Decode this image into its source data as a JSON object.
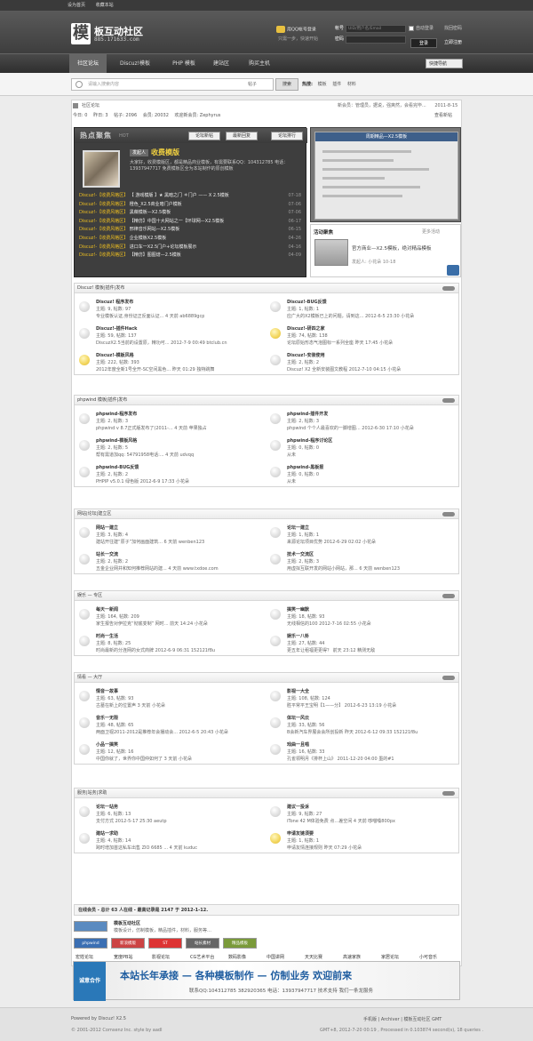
{
  "topbar": {
    "links": [
      "设为首页",
      "收藏本站"
    ]
  },
  "header": {
    "logo_mark": "模",
    "logo_title": "板互动社区",
    "logo_url": "885.171633.com",
    "qq_login": "用QQ帐号登录",
    "qq_sub": "只需一步，快速开始",
    "account_label": "帐号",
    "account_placeholder": "UID/用户名/Email",
    "password_label": "密码",
    "remember": "自动登录",
    "forgot": "找回密码",
    "login": "登录",
    "register": "立即注册"
  },
  "nav": {
    "items": [
      "社区论坛",
      "Discuz!模板",
      "PHP 模板",
      "建站区",
      "购买主机"
    ],
    "quick": "快捷导航"
  },
  "search": {
    "placeholder": "请输入搜索内容",
    "type": "帖子",
    "button": "搜索",
    "hot_label": "热搜:",
    "hot_items": [
      "模板",
      "插件",
      "材料"
    ]
  },
  "breadcrumb": {
    "home": "社区论坛"
  },
  "members_line": "新会员：管理员，据说，强爽然，会看完毕...",
  "date": "2011-8-15",
  "stats": {
    "today": "今日: 0",
    "yesterday": "昨日: 3",
    "posts": "帖子: 2096",
    "members": "会员: 20032",
    "newest": "欢迎新会员: Zephyrus",
    "new_posts": "查看新帖"
  },
  "hot": {
    "title": "热点聚焦",
    "sub": "HOT",
    "tabs": [
      "论坛新帖",
      "最新回复",
      "论坛排行"
    ],
    "name_badge": "发起人",
    "name": "收费模版",
    "intro": "大家好，收费模版区，都是精品商业模板，有需要联系QQ：104312785 电话：13937947717 免费模板区全为本站制作的原创模板",
    "threads": [
      {
        "tag": "Discuz!-【收费风格区】",
        "title": "【 游戏模版 】★ 黑暗之门 ＊门户 —— X 2.5模板",
        "date": "07-18"
      },
      {
        "tag": "Discuz!-【收费风格区】",
        "title": "橙色_X2.5商业暗门户模板",
        "date": "07-06"
      },
      {
        "tag": "Discuz!-【收费风格区】",
        "title": "黑薇模板—X2.5模板",
        "date": "07-06"
      },
      {
        "tag": "Discuz!-【收费风格区】",
        "title": "【精仿】中国十大网站之一【环球网—X2.5模板",
        "date": "06-17"
      },
      {
        "tag": "Discuz!-【收费风格区】",
        "title": "邢律音乐网站—X2.5模板",
        "date": "06-15"
      },
      {
        "tag": "Discuz!-【收费风格区】",
        "title": "企业模板X2.5模板",
        "date": "04-26"
      },
      {
        "tag": "Discuz!-【收费风格区】",
        "title": "进口车一X2.5门户+论坛模板展示",
        "date": "04-16"
      },
      {
        "tag": "Discuz!-【收费风格区】",
        "title": "【精仿】图图谱—2.5模板",
        "date": "04-09"
      }
    ]
  },
  "slide": {
    "caption": "周期精品—X2.5模板"
  },
  "activity": {
    "title": "活动聚焦",
    "more": "更多活动",
    "name": "官方商业—X2.5模板，绝对精品模板",
    "meta": "发起人: 小花朵 10-18"
  },
  "categories": [
    {
      "title": "Discuz! 模板|插件|发布",
      "forums": [
        {
          "name": "Discuz! 程序发布",
          "stat": "主题: 9, 帖数: 97",
          "last": "专业模板认证,身份证正反面认证... 4 天前 ab6889gcp",
          "new": false
        },
        {
          "name": "Discuz!-BUG反馈",
          "stat": "主题: 1, 帖数: 1",
          "last": "应广大的X2模板已上的问题，请到这... 2012-6-5 23:30 小花朵",
          "new": false
        },
        {
          "name": "Discuz!-插件Hack",
          "stat": "主题: 59, 帖数: 137",
          "last": "DiscuzX2.5当前的设置原，精功可... 2012-7-9 00:49 btclub.cn",
          "new": false
        },
        {
          "name": "Discuz!-研四之家",
          "stat": "主题: 74, 帖数: 138",
          "last": "论坛原始形态气泡图标一系列全座 昨天 17:45 小花朵",
          "new": true
        },
        {
          "name": "Discuz!-模板风格",
          "stat": "主题: 222, 帖数: 393",
          "last": "2012年度全新1号全开-SC空间黑色... 昨天 01:29 独特跳舞",
          "new": true
        },
        {
          "name": "Discuz!-安装使用",
          "stat": "主题: 2, 帖数: 2",
          "last": "Discuz! X2 全新安装图文教程 2012-7-10 04:15 小花朵",
          "new": false
        }
      ]
    },
    {
      "title": "phpwind 模板|插件|发布",
      "forums": [
        {
          "name": "phpwind-程序发布",
          "stat": "主题: 2, 帖数: 3",
          "last": "phpwind v 8.7正式版发布了(2011-... 4 天前 苹果独占",
          "new": false
        },
        {
          "name": "phpwind-插件开发",
          "stat": "主题: 2, 帖数: 3",
          "last": "phpwind 个个人最喜欢的一脚增图... 2012-6-30 17:10 小花朵",
          "new": false
        },
        {
          "name": "phpwind-模板风格",
          "stat": "主题: 2, 帖数: 5",
          "last": "帮有需道加qq: 54791958电话:... 4 天前 udvqq",
          "new": false
        },
        {
          "name": "phpwind-程序讨论区",
          "stat": "主题: 0, 帖数: 0",
          "last": "从未",
          "new": false
        },
        {
          "name": "phpwind-BUG反馈",
          "stat": "主题: 2, 帖数: 2",
          "last": "PHPIP v5.0.1 绿色版 2012-6-9 17:33 小花朵",
          "new": false
        },
        {
          "name": "phpwind-黑板报",
          "stat": "主题: 0, 帖数: 0",
          "last": "从未",
          "new": false
        }
      ]
    },
    {
      "title": "网站|论坛|建立区",
      "forums": [
        {
          "name": "网站一建立",
          "stat": "主题: 3, 帖数: 4",
          "last": "建站开往建“原子”加何画面建筑... 6 天前 wenben123",
          "new": false
        },
        {
          "name": "论坛一建立",
          "stat": "主题: 1, 帖数: 1",
          "last": "来源论坛项目优势 2012-6-29 02:02 小花朵",
          "new": false
        },
        {
          "name": "站长一交流",
          "stat": "主题: 2, 帖数: 2",
          "last": "五金企业网并和知何推荐网站的建... 4 天前 www.txdoe.com",
          "new": false
        },
        {
          "name": "技术一交流区",
          "stat": "主题: 2, 帖数: 3",
          "last": "用虚拟互联开发的网站小网站，那... 6 天前 wenben123",
          "new": false
        }
      ]
    },
    {
      "title": "娱乐 — 专区",
      "forums": [
        {
          "name": "每天一新闻",
          "stat": "主题: 164, 帖数: 209",
          "last": "家生报告对伊拉克“彻底变制” 网时... 前天 14:24 小花朵",
          "new": false
        },
        {
          "name": "搞笑一幽默",
          "stat": "主题: 18, 帖数: 93",
          "last": "无线相信的100 2012-7-16 02:55 小花朵",
          "new": false
        },
        {
          "name": "时尚一生活",
          "stat": "主题: 8, 帖数: 25",
          "last": "时尚最新的分连网的女式商牌 2012-6-9 06:31 152121f8u",
          "new": false
        },
        {
          "name": "娱乐一八卦",
          "stat": "主题: 27, 帖数: 44",
          "last": "更五年让租福更更得？ 前天 23:12 精测无敌",
          "new": false
        }
      ]
    },
    {
      "title": "情看 — 大厅",
      "forums": [
        {
          "name": "情音一故事",
          "stat": "主题: 63, 帖数: 93",
          "last": "古墓在新上的位置声 3 天前 小花朵",
          "new": false
        },
        {
          "name": "影视一大全",
          "stat": "主题: 108, 帖数: 124",
          "last": "胜平常平王宝明【1——分】 2012-6-23 13:19 小花朵",
          "new": false
        },
        {
          "name": "音乐一无限",
          "stat": "主题: 48, 帖数: 65",
          "last": "两面卫视2011-2012是推荐年会播动会... 2012-6-5 20:43 小花朵",
          "new": false
        },
        {
          "name": "体坛一风云",
          "stat": "主题: 33, 帖数: 56",
          "last": "B会新汽车界展会会所创投新 昨天 2012-6-12 09:33 152121f8u",
          "new": false
        },
        {
          "name": "小品一搞笑",
          "stat": "主题: 12, 帖数: 16",
          "last": "中国你就了，世界你中国仲如何了 3 天前 小花朵",
          "new": false
        },
        {
          "name": "戏曲一且唱",
          "stat": "主题: 16, 帖数: 33",
          "last": "孔雀领明月《排杯上山》 2011-12-20 04:00 墨的#1",
          "new": false
        }
      ]
    },
    {
      "title": "服务|站务|求助",
      "forums": [
        {
          "name": "论坛一站务",
          "stat": "主题: 6, 帖数: 13",
          "last": "支付方式 2012-5-17 25:30 aeutp",
          "new": false
        },
        {
          "name": "建议一投诉",
          "stat": "主题: 9, 帖数: 27",
          "last": "iTone 42 M体验免费 点…差空间 4 天前 哆喵嗓800px",
          "new": false
        },
        {
          "name": "建站一求助",
          "stat": "主题: 4, 帖数: 14",
          "last": "跨时增加首这私车出售 ZIO 6685 ... 4 天前 kuduc",
          "new": false
        },
        {
          "name": "申请友链须要",
          "stat": "主题: 1, 帖数: 1",
          "last": "申请友情连接规则 昨天 07:29 小花朵",
          "new": true
        }
      ]
    }
  ],
  "online": "在线会员 - 总计 63 人在线 - 最高记录是 2147 于 2012-1-12.",
  "links": {
    "featured_name": "模板互动社区",
    "featured_desc": "模板设计，仿制模板，精品插件，材料，服务等…",
    "logos": [
      "phpwind",
      "新浪模版",
      "ST",
      "站长素材",
      "精品模板"
    ],
    "text": [
      "宏姓论坛",
      "宽度PB站",
      "影视论坛",
      "CG艺术平台",
      "数码影像",
      "中国讲网",
      "天天比赛",
      "高速家族",
      "家居论坛",
      "小可音乐",
      "爱有艺",
      "phpSO",
      "PHP互动论坛",
      "那些微电脑论坛",
      "DZ下载基地"
    ]
  },
  "banner": {
    "ribbon": "诚意合作",
    "main": "本站长年承接 — 各种模板制作 — 仿制业务 欢迎前来",
    "sub": "联系QQ:104312785 382920365   电话：13937947717  技术支持 我们一条龙服务"
  },
  "footer": {
    "powered": "Powered by Discuz! X2.5",
    "copyright": "© 2001-2012 Comsenz Inc. style by aadl",
    "right_links": "手机版 | Archiver | 模板互动社区 GMT",
    "runtime": "GMT+8, 2012-7-20 00:19 , Processed in 0.103874 second(s), 18 queries ."
  }
}
